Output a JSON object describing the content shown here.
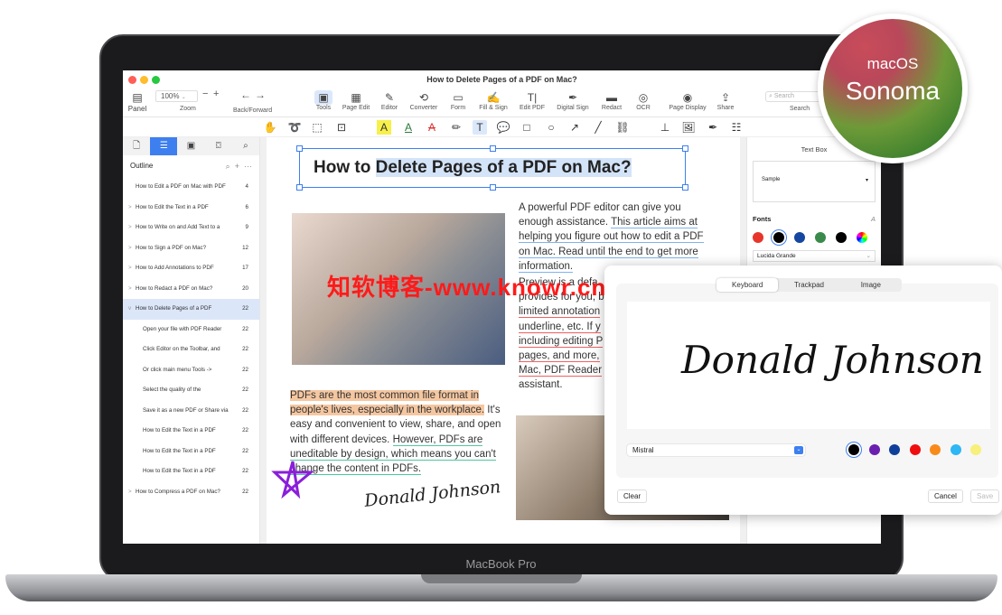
{
  "window": {
    "title": "How to Delete Pages of a PDF on Mac?"
  },
  "toolbar": {
    "panel": "Panel",
    "zoom_value": "100%",
    "zoom_label": "Zoom",
    "zoom_minus": "−",
    "zoom_plus": "+",
    "back_forward": "Back/Forward",
    "back": "←",
    "forward": "→",
    "items": [
      {
        "label": "Tools",
        "icon": "toolbox-icon",
        "glyph": "▣"
      },
      {
        "label": "Page Edit",
        "icon": "grid-icon",
        "glyph": "▦"
      },
      {
        "label": "Editor",
        "icon": "edit-icon",
        "glyph": "✎"
      },
      {
        "label": "Converter",
        "icon": "convert-icon",
        "glyph": "⟲"
      },
      {
        "label": "Form",
        "icon": "form-icon",
        "glyph": "▭"
      },
      {
        "label": "Fill & Sign",
        "icon": "fill-sign-icon",
        "glyph": "✍"
      },
      {
        "label": "Edit PDF",
        "icon": "text-cursor-icon",
        "glyph": "T|"
      },
      {
        "label": "Digital Sign",
        "icon": "pen-nib-icon",
        "glyph": "✒"
      },
      {
        "label": "Redact",
        "icon": "redact-icon",
        "glyph": "▬"
      },
      {
        "label": "OCR",
        "icon": "ocr-icon",
        "glyph": "◎"
      },
      {
        "label": "Page Display",
        "icon": "eye-icon",
        "glyph": "◉"
      },
      {
        "label": "Share",
        "icon": "share-icon",
        "glyph": "⇪"
      }
    ],
    "search_placeholder": "Search",
    "search_label": "Search"
  },
  "annot_tools": [
    {
      "icon": "hand-icon",
      "glyph": "✋"
    },
    {
      "icon": "lasso-icon",
      "glyph": "➰"
    },
    {
      "icon": "select-box-icon",
      "glyph": "⬚"
    },
    {
      "icon": "zoom-area-icon",
      "glyph": "⊡"
    },
    {
      "icon": "highlight-icon",
      "glyph": "A"
    },
    {
      "icon": "underline-icon",
      "glyph": "A"
    },
    {
      "icon": "strikethrough-icon",
      "glyph": "A"
    },
    {
      "icon": "pencil-icon",
      "glyph": "✏"
    },
    {
      "icon": "text-icon",
      "glyph": "T"
    },
    {
      "icon": "comment-icon",
      "glyph": "💬"
    },
    {
      "icon": "rectangle-icon",
      "glyph": "□"
    },
    {
      "icon": "circle-icon",
      "glyph": "○"
    },
    {
      "icon": "arrow-icon",
      "glyph": "↗"
    },
    {
      "icon": "line-icon",
      "glyph": "╱"
    },
    {
      "icon": "link-icon",
      "glyph": "⛓"
    },
    {
      "icon": "stamp-icon",
      "glyph": "⊥"
    },
    {
      "icon": "image-icon",
      "glyph": "🖼"
    },
    {
      "icon": "signature-icon",
      "glyph": "✒"
    },
    {
      "icon": "table-icon",
      "glyph": "☷"
    }
  ],
  "sidebar": {
    "tabs": [
      {
        "icon": "page-icon",
        "glyph": "🗋"
      },
      {
        "icon": "outline-icon",
        "glyph": "☰"
      },
      {
        "icon": "bookmark-icon",
        "glyph": "▣"
      },
      {
        "icon": "camera-icon",
        "glyph": "⌼"
      },
      {
        "icon": "search-icon",
        "glyph": "⌕"
      }
    ],
    "outline_title": "Outline",
    "items": [
      {
        "label": "How to Edit a PDF on Mac with PDF",
        "page": "4",
        "level": 0,
        "chev": ""
      },
      {
        "label": "How to Edit the Text in a PDF",
        "page": "6",
        "level": 0,
        "chev": ">"
      },
      {
        "label": "How to Write on and Add Text to a",
        "page": "9",
        "level": 0,
        "chev": ">"
      },
      {
        "label": "How to Sign a PDF on Mac?",
        "page": "12",
        "level": 0,
        "chev": ">"
      },
      {
        "label": "How to Add Annotations to PDF",
        "page": "17",
        "level": 0,
        "chev": ">"
      },
      {
        "label": "How to Redact a PDF on Mac?",
        "page": "20",
        "level": 0,
        "chev": ">"
      },
      {
        "label": "How to Delete Pages of a PDF",
        "page": "22",
        "level": 0,
        "chev": "v",
        "selected": true
      },
      {
        "label": "Open your file with PDF Reader",
        "page": "22",
        "level": 1,
        "chev": ""
      },
      {
        "label": "Click Editor on the Toolbar, and",
        "page": "22",
        "level": 1,
        "chev": ""
      },
      {
        "label": "Or click main menu Tools ->",
        "page": "22",
        "level": 1,
        "chev": ""
      },
      {
        "label": "Select the quality of the",
        "page": "22",
        "level": 1,
        "chev": ""
      },
      {
        "label": "Save it as a new PDF or Share via",
        "page": "22",
        "level": 1,
        "chev": ""
      },
      {
        "label": "How to Edit the Text in a PDF",
        "page": "22",
        "level": 1,
        "chev": ""
      },
      {
        "label": "How to Edit the Text in a PDF",
        "page": "22",
        "level": 1,
        "chev": ""
      },
      {
        "label": "How to Edit the Text in a PDF",
        "page": "22",
        "level": 1,
        "chev": ""
      },
      {
        "label": "How to Compress a PDF on Mac?",
        "page": "22",
        "level": 0,
        "chev": ">"
      }
    ]
  },
  "document": {
    "heading_prefix": "How to ",
    "heading_selected": "Delete Pages of a PDF on Mac?",
    "p1": [
      {
        "t": "A powerful PDF editor can give you enough assistance. ",
        "s": ""
      },
      {
        "t": "This article aims at helping you figure out how to edit a PDF on Mac. Read until the end to get more information.",
        "s": "ub"
      }
    ],
    "p2_lines": [
      "Preview is a defa",
      "provides for you, b",
      "limited annotation",
      "underline, etc. If y",
      "including editing P",
      "pages, and more,",
      "Mac, PDF Reader",
      "assistant."
    ],
    "p3_highlight": "PDFs are the most common file format in people's lives, especially in the workplace.",
    "p3_plain": " It's easy and convenient to view, share, and open with different devices. ",
    "p3_green": "However, PDFs are uneditable by design, which means you can't change the content in PDFs.",
    "signature": "Donald Johnson"
  },
  "properties": {
    "title": "Text Box",
    "sample": "Sample",
    "fonts_label": "Fonts",
    "font_icon": "A",
    "font_name": "Lucida Grande",
    "colors": [
      "#e8352b",
      "#000000",
      "#1546a0",
      "#3a8a4b",
      "#000000",
      "rainbow"
    ]
  },
  "signature_dialog": {
    "tabs": [
      "Keyboard",
      "Trackpad",
      "Image"
    ],
    "active_tab": "Keyboard",
    "signature": "Donald Johnson",
    "font": "Mistral",
    "colors": [
      "#000000",
      "#6a1fb0",
      "#0f3f9a",
      "#f00d0d",
      "#f98a1a",
      "#2eb6f5",
      "#f7f07a"
    ],
    "clear": "Clear",
    "cancel": "Cancel",
    "save": "Save"
  },
  "badge": {
    "line1": "macOS",
    "line2": "Sonoma"
  },
  "device_label": "MacBook Pro",
  "watermark": "知软博客-www.knowr.cn"
}
